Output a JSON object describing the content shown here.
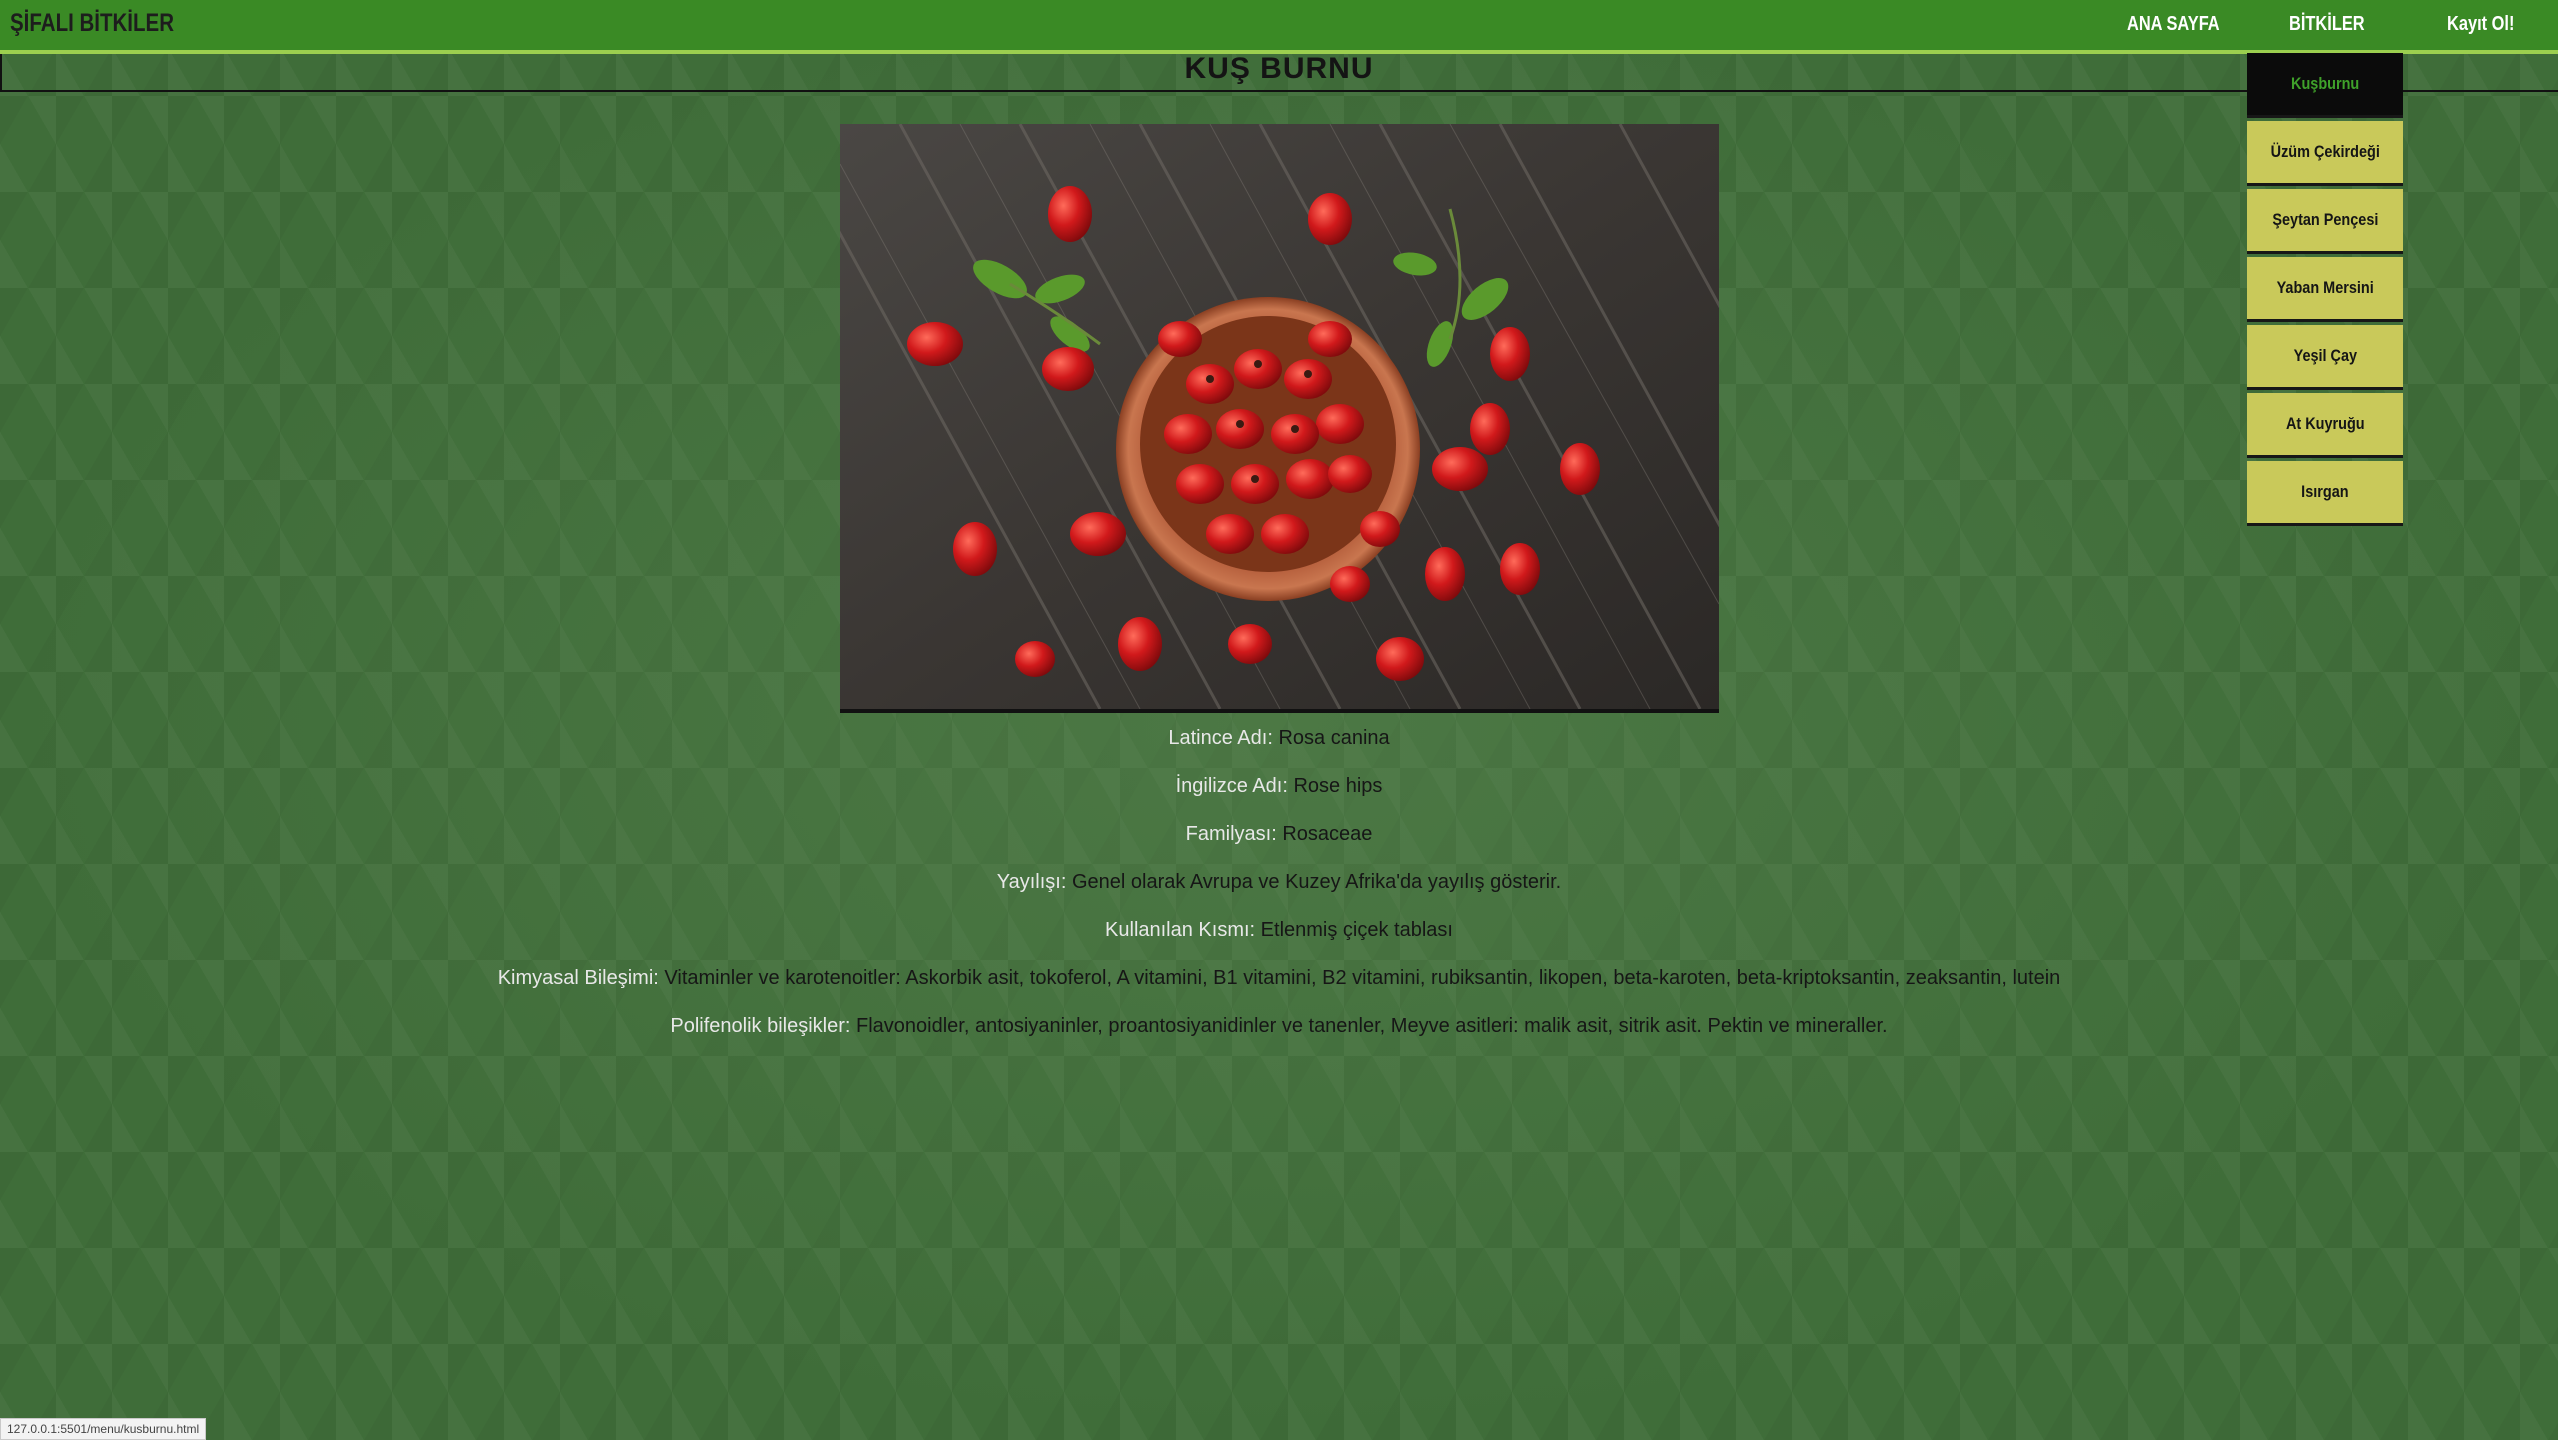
{
  "header": {
    "brand": "ŞİFALI BİTKİLER",
    "nav": [
      "ANA SAYFA",
      "BİTKİLER",
      "Kayıt Ol!"
    ]
  },
  "page": {
    "title": "KUŞ BURNU"
  },
  "image": {
    "icon": "rosehip-bowl-photo"
  },
  "info": [
    {
      "label": "Latince Adı:",
      "value": "Rosa canina"
    },
    {
      "label": "İngilizce Adı:",
      "value": "Rose hips"
    },
    {
      "label": "Familyası:",
      "value": "Rosaceae"
    },
    {
      "label": "Yayılışı:",
      "value": "Genel olarak Avrupa ve Kuzey Afrika'da yayılış gösterir."
    },
    {
      "label": "Kullanılan Kısmı:",
      "value": "Etlenmiş çiçek tablası"
    },
    {
      "label": "Kimyasal Bileşimi:",
      "value": "Vitaminler ve karotenoitler: Askorbik asit, tokoferol, A vitamini, B1 vitamini, B2 vitamini, rubiksantin, likopen, beta-karoten, beta-kriptoksantin, zeaksantin, lutein"
    },
    {
      "label": "Polifenolik bileşikler:",
      "value": "Flavonoidler, antosiyaninler, proantosiyanidinler ve tanenler, Meyve asitleri: malik asit, sitrik asit. Pektin ve mineraller."
    }
  ],
  "dropdown": {
    "items": [
      "Kuşburnu",
      "Üzüm Çekirdeği",
      "Şeytan Pençesi",
      "Yaban Mersini",
      "Yeşil Çay",
      "At Kuyruğu",
      "Isırgan"
    ],
    "active_index": 0
  },
  "status_bar": {
    "url": "127.0.0.1:5501/menu/kusburnu.html"
  },
  "colors": {
    "topbar": "#3a8a25",
    "topbar_border": "#9ccf4f",
    "dropdown_item": "#c9c95a",
    "dropdown_active_bg": "#0b0b0b",
    "dropdown_active_text": "#3fa12a",
    "page_bg": "#3f6d39"
  }
}
